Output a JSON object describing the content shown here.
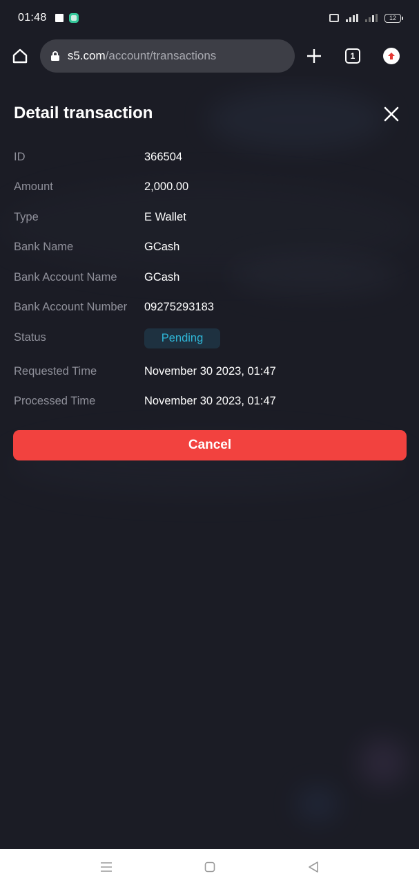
{
  "status_bar": {
    "time": "01:48",
    "battery": "12"
  },
  "browser": {
    "url_domain": "s5.com",
    "url_path": "/account/transactions",
    "tab_count": "1"
  },
  "modal": {
    "title": "Detail transaction",
    "rows": [
      {
        "label": "ID",
        "value": "366504"
      },
      {
        "label": "Amount",
        "value": "2,000.00"
      },
      {
        "label": "Type",
        "value": "E Wallet"
      },
      {
        "label": "Bank Name",
        "value": "GCash"
      },
      {
        "label": "Bank Account Name",
        "value": "GCash"
      },
      {
        "label": "Bank Account Number",
        "value": "09275293183"
      },
      {
        "label": "Status",
        "value": "Pending"
      },
      {
        "label": "Requested Time",
        "value": "November 30 2023, 01:47"
      },
      {
        "label": "Processed Time",
        "value": "November 30 2023, 01:47"
      }
    ],
    "cancel_label": "Cancel"
  },
  "colors": {
    "background": "#1b1c25",
    "cancel_button": "#f2423f",
    "status_pending_text": "#2fb6d7",
    "status_pending_bg": "#1e3140",
    "label_text": "#8f909a"
  },
  "icons": {
    "home": "home-icon",
    "lock": "lock-icon",
    "new_tab": "plus-icon",
    "tabs": "tabs-icon",
    "extension": "upload-arrow-icon",
    "close": "close-icon",
    "nav_menu": "menu-icon",
    "nav_home": "square-icon",
    "nav_back": "back-triangle-icon"
  }
}
